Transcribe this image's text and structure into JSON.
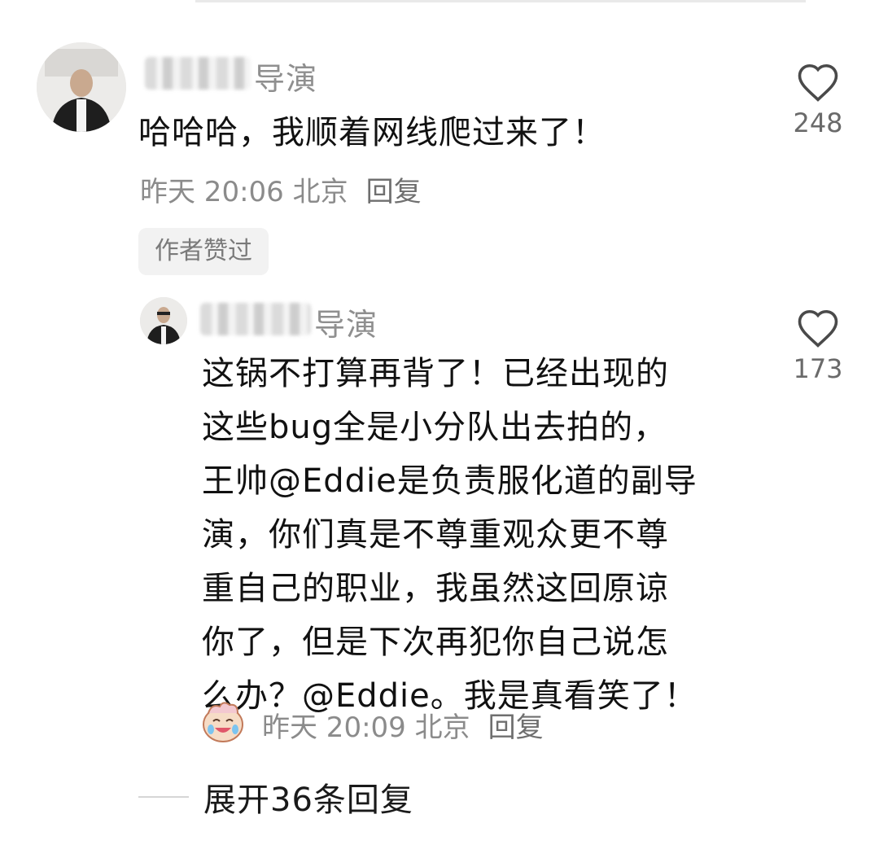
{
  "comments": [
    {
      "username": "导演",
      "text": "哈哈哈，我顺着网线爬过来了！",
      "time": "昨天 20:06 北京",
      "reply_label": "回复",
      "badge": "作者赞过",
      "likes": "248"
    },
    {
      "username": "导演",
      "text_lines": [
        "这锅不打算再背了！已经出现的",
        "这些bug全是小分队出去拍的，",
        "王帅@Eddie是负责服化道的副导",
        "演，你们真是不尊重观众更不尊",
        "重自己的职业，我虽然这回原谅",
        "你了，但是下次再犯你自己说怎",
        "么办？@Eddie。我是真看笑了！"
      ],
      "time": "昨天 20:09 北京",
      "reply_label": "回复",
      "likes": "173"
    }
  ],
  "expand_label": "展开36条回复",
  "icons": {
    "like": "heart-outline-icon",
    "sticker": "laughing-face-sticker-icon"
  }
}
